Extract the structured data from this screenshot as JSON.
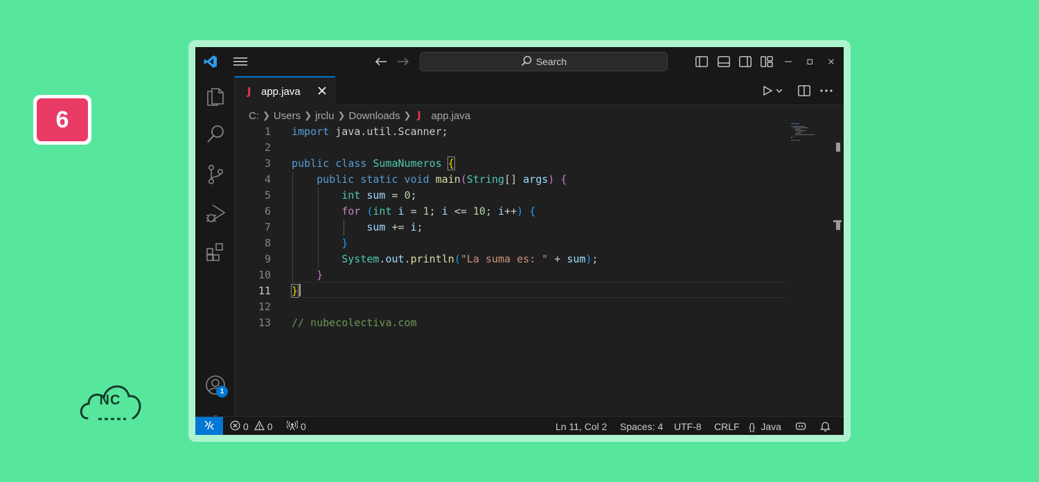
{
  "step_badge": "6",
  "logo": {
    "text": "NC"
  },
  "titlebar": {
    "search_label": "Search"
  },
  "tab": {
    "label": "app.java",
    "icon_glyph": "J"
  },
  "breadcrumb": [
    "C:",
    "Users",
    "jrclu",
    "Downloads",
    "app.java"
  ],
  "editor": {
    "active_line": 11,
    "line_numbers": [
      "1",
      "2",
      "3",
      "4",
      "5",
      "6",
      "7",
      "8",
      "9",
      "10",
      "11",
      "12",
      "13"
    ]
  },
  "activity_bar": {
    "accounts_badge": "1"
  },
  "status_bar": {
    "errors": "0",
    "warnings": "0",
    "ports": "0",
    "position": "Ln 11, Col 2",
    "spaces": "Spaces: 4",
    "encoding": "UTF-8",
    "eol": "CRLF",
    "language_braces": "{}",
    "language": "Java"
  },
  "colors": {
    "background": "#56e79c",
    "badge": "#ea3b67",
    "accent": "#0078d4",
    "java_icon": "#e5394a"
  },
  "icons": [
    "vscode-logo-icon",
    "menu-icon",
    "back-arrow-icon",
    "forward-arrow-icon",
    "search-icon",
    "toggle-primary-sidebar-icon",
    "toggle-panel-icon",
    "toggle-secondary-sidebar-icon",
    "customize-layout-icon",
    "minimize-icon",
    "maximize-icon",
    "close-icon",
    "explorer-icon",
    "search-view-icon",
    "source-control-icon",
    "run-debug-icon",
    "extensions-icon",
    "accounts-icon",
    "manage-gear-icon",
    "run-icon",
    "split-editor-icon",
    "more-actions-icon",
    "remote-icon",
    "error-icon",
    "warning-icon",
    "ports-icon",
    "copilot-icon",
    "bell-icon"
  ]
}
